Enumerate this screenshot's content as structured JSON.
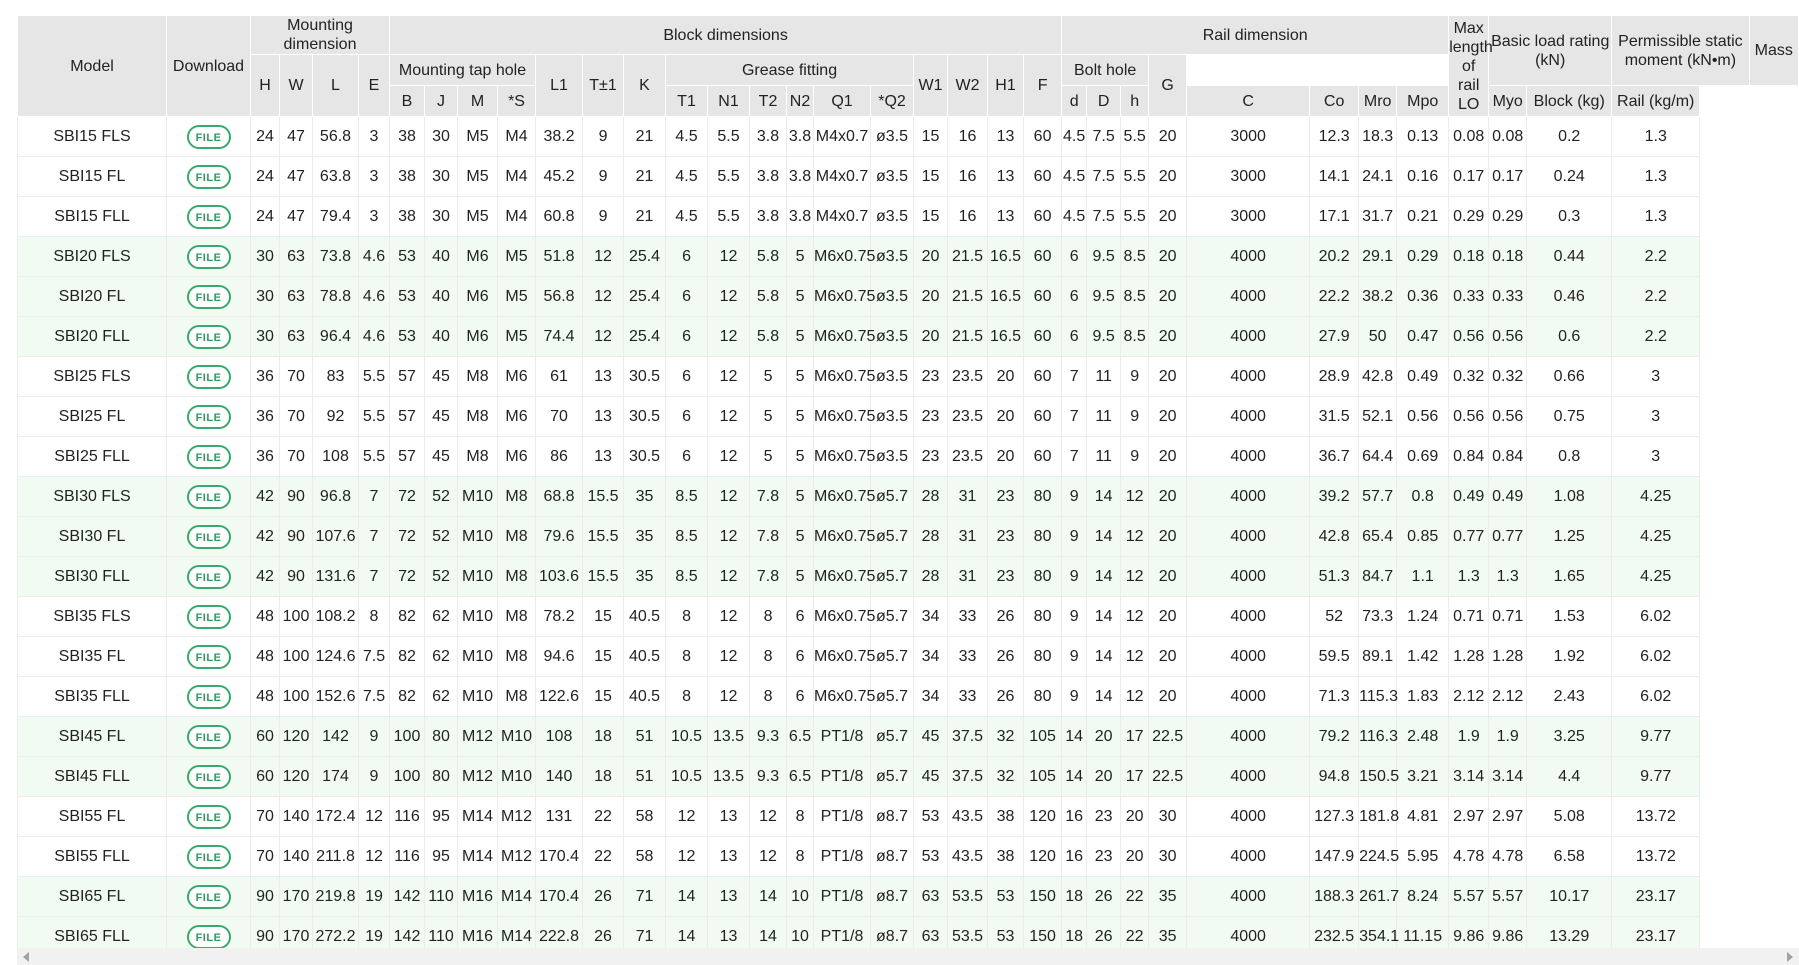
{
  "headers": {
    "model": "Model",
    "download": "Download",
    "groups": {
      "mounting": "Mounting dimension",
      "block": "Block dimensions",
      "rail": "Rail dimension",
      "max_length": "Max length of rail LO",
      "load": "Basic load rating (kN)",
      "moment": "Permissible static moment (kN•m)",
      "mass": "Mass"
    },
    "subgroups": {
      "tap_hole": "Mounting tap hole",
      "grease": "Grease fitting",
      "bolt_hole": "Bolt hole"
    },
    "columns": {
      "H": "H",
      "W": "W",
      "L": "L",
      "E": "E",
      "B": "B",
      "J": "J",
      "M": "M",
      "S": "*S",
      "L1": "L1",
      "T": "T±1",
      "K": "K",
      "T1": "T1",
      "N1": "N1",
      "T2": "T2",
      "N2": "N2",
      "Q1": "Q1",
      "Q2": "*Q2",
      "W1": "W1",
      "W2": "W2",
      "H1": "H1",
      "F": "F",
      "d": "d",
      "D": "D",
      "h": "h",
      "G": "G",
      "C": "C",
      "Co": "Co",
      "Mro": "Mro",
      "Mpo": "Mpo",
      "Myo": "Myo",
      "block": "Block (kg)",
      "rail": "Rail (kg/m)"
    }
  },
  "file_label": "FILE",
  "colors": {
    "row_white": "#ffffff",
    "row_green": "#f2fbf1",
    "header_bg": "#e6e6e6",
    "file_accent": "#3aa86b"
  },
  "rows": [
    {
      "model": "SBI15 FLS",
      "H": "24",
      "W": "47",
      "L": "56.8",
      "E": "3",
      "B": "38",
      "J": "30",
      "M": "M5",
      "S": "M4",
      "L1": "38.2",
      "T": "9",
      "K": "21",
      "T1": "4.5",
      "N1": "5.5",
      "T2": "3.8",
      "N2": "3.8",
      "Q1": "M4x0.7",
      "Q2": "ø3.5",
      "W1": "15",
      "W2": "16",
      "H1": "13",
      "F": "60",
      "d": "4.5",
      "D": "7.5",
      "h": "5.5",
      "G": "20",
      "LO": "3000",
      "C": "12.3",
      "Co": "18.3",
      "Mro": "0.13",
      "Mpo": "0.08",
      "Myo": "0.08",
      "block": "0.2",
      "rail": "1.3"
    },
    {
      "model": "SBI15 FL",
      "H": "24",
      "W": "47",
      "L": "63.8",
      "E": "3",
      "B": "38",
      "J": "30",
      "M": "M5",
      "S": "M4",
      "L1": "45.2",
      "T": "9",
      "K": "21",
      "T1": "4.5",
      "N1": "5.5",
      "T2": "3.8",
      "N2": "3.8",
      "Q1": "M4x0.7",
      "Q2": "ø3.5",
      "W1": "15",
      "W2": "16",
      "H1": "13",
      "F": "60",
      "d": "4.5",
      "D": "7.5",
      "h": "5.5",
      "G": "20",
      "LO": "3000",
      "C": "14.1",
      "Co": "24.1",
      "Mro": "0.16",
      "Mpo": "0.17",
      "Myo": "0.17",
      "block": "0.24",
      "rail": "1.3"
    },
    {
      "model": "SBI15 FLL",
      "H": "24",
      "W": "47",
      "L": "79.4",
      "E": "3",
      "B": "38",
      "J": "30",
      "M": "M5",
      "S": "M4",
      "L1": "60.8",
      "T": "9",
      "K": "21",
      "T1": "4.5",
      "N1": "5.5",
      "T2": "3.8",
      "N2": "3.8",
      "Q1": "M4x0.7",
      "Q2": "ø3.5",
      "W1": "15",
      "W2": "16",
      "H1": "13",
      "F": "60",
      "d": "4.5",
      "D": "7.5",
      "h": "5.5",
      "G": "20",
      "LO": "3000",
      "C": "17.1",
      "Co": "31.7",
      "Mro": "0.21",
      "Mpo": "0.29",
      "Myo": "0.29",
      "block": "0.3",
      "rail": "1.3"
    },
    {
      "model": "SBI20 FLS",
      "H": "30",
      "W": "63",
      "L": "73.8",
      "E": "4.6",
      "B": "53",
      "J": "40",
      "M": "M6",
      "S": "M5",
      "L1": "51.8",
      "T": "12",
      "K": "25.4",
      "T1": "6",
      "N1": "12",
      "T2": "5.8",
      "N2": "5",
      "Q1": "M6x0.75",
      "Q2": "ø3.5",
      "W1": "20",
      "W2": "21.5",
      "H1": "16.5",
      "F": "60",
      "d": "6",
      "D": "9.5",
      "h": "8.5",
      "G": "20",
      "LO": "4000",
      "C": "20.2",
      "Co": "29.1",
      "Mro": "0.29",
      "Mpo": "0.18",
      "Myo": "0.18",
      "block": "0.44",
      "rail": "2.2"
    },
    {
      "model": "SBI20 FL",
      "H": "30",
      "W": "63",
      "L": "78.8",
      "E": "4.6",
      "B": "53",
      "J": "40",
      "M": "M6",
      "S": "M5",
      "L1": "56.8",
      "T": "12",
      "K": "25.4",
      "T1": "6",
      "N1": "12",
      "T2": "5.8",
      "N2": "5",
      "Q1": "M6x0.75",
      "Q2": "ø3.5",
      "W1": "20",
      "W2": "21.5",
      "H1": "16.5",
      "F": "60",
      "d": "6",
      "D": "9.5",
      "h": "8.5",
      "G": "20",
      "LO": "4000",
      "C": "22.2",
      "Co": "38.2",
      "Mro": "0.36",
      "Mpo": "0.33",
      "Myo": "0.33",
      "block": "0.46",
      "rail": "2.2"
    },
    {
      "model": "SBI20 FLL",
      "H": "30",
      "W": "63",
      "L": "96.4",
      "E": "4.6",
      "B": "53",
      "J": "40",
      "M": "M6",
      "S": "M5",
      "L1": "74.4",
      "T": "12",
      "K": "25.4",
      "T1": "6",
      "N1": "12",
      "T2": "5.8",
      "N2": "5",
      "Q1": "M6x0.75",
      "Q2": "ø3.5",
      "W1": "20",
      "W2": "21.5",
      "H1": "16.5",
      "F": "60",
      "d": "6",
      "D": "9.5",
      "h": "8.5",
      "G": "20",
      "LO": "4000",
      "C": "27.9",
      "Co": "50",
      "Mro": "0.47",
      "Mpo": "0.56",
      "Myo": "0.56",
      "block": "0.6",
      "rail": "2.2"
    },
    {
      "model": "SBI25 FLS",
      "H": "36",
      "W": "70",
      "L": "83",
      "E": "5.5",
      "B": "57",
      "J": "45",
      "M": "M8",
      "S": "M6",
      "L1": "61",
      "T": "13",
      "K": "30.5",
      "T1": "6",
      "N1": "12",
      "T2": "5",
      "N2": "5",
      "Q1": "M6x0.75",
      "Q2": "ø3.5",
      "W1": "23",
      "W2": "23.5",
      "H1": "20",
      "F": "60",
      "d": "7",
      "D": "11",
      "h": "9",
      "G": "20",
      "LO": "4000",
      "C": "28.9",
      "Co": "42.8",
      "Mro": "0.49",
      "Mpo": "0.32",
      "Myo": "0.32",
      "block": "0.66",
      "rail": "3"
    },
    {
      "model": "SBI25 FL",
      "H": "36",
      "W": "70",
      "L": "92",
      "E": "5.5",
      "B": "57",
      "J": "45",
      "M": "M8",
      "S": "M6",
      "L1": "70",
      "T": "13",
      "K": "30.5",
      "T1": "6",
      "N1": "12",
      "T2": "5",
      "N2": "5",
      "Q1": "M6x0.75",
      "Q2": "ø3.5",
      "W1": "23",
      "W2": "23.5",
      "H1": "20",
      "F": "60",
      "d": "7",
      "D": "11",
      "h": "9",
      "G": "20",
      "LO": "4000",
      "C": "31.5",
      "Co": "52.1",
      "Mro": "0.56",
      "Mpo": "0.56",
      "Myo": "0.56",
      "block": "0.75",
      "rail": "3"
    },
    {
      "model": "SBI25 FLL",
      "H": "36",
      "W": "70",
      "L": "108",
      "E": "5.5",
      "B": "57",
      "J": "45",
      "M": "M8",
      "S": "M6",
      "L1": "86",
      "T": "13",
      "K": "30.5",
      "T1": "6",
      "N1": "12",
      "T2": "5",
      "N2": "5",
      "Q1": "M6x0.75",
      "Q2": "ø3.5",
      "W1": "23",
      "W2": "23.5",
      "H1": "20",
      "F": "60",
      "d": "7",
      "D": "11",
      "h": "9",
      "G": "20",
      "LO": "4000",
      "C": "36.7",
      "Co": "64.4",
      "Mro": "0.69",
      "Mpo": "0.84",
      "Myo": "0.84",
      "block": "0.8",
      "rail": "3"
    },
    {
      "model": "SBI30 FLS",
      "H": "42",
      "W": "90",
      "L": "96.8",
      "E": "7",
      "B": "72",
      "J": "52",
      "M": "M10",
      "S": "M8",
      "L1": "68.8",
      "T": "15.5",
      "K": "35",
      "T1": "8.5",
      "N1": "12",
      "T2": "7.8",
      "N2": "5",
      "Q1": "M6x0.75",
      "Q2": "ø5.7",
      "W1": "28",
      "W2": "31",
      "H1": "23",
      "F": "80",
      "d": "9",
      "D": "14",
      "h": "12",
      "G": "20",
      "LO": "4000",
      "C": "39.2",
      "Co": "57.7",
      "Mro": "0.8",
      "Mpo": "0.49",
      "Myo": "0.49",
      "block": "1.08",
      "rail": "4.25"
    },
    {
      "model": "SBI30 FL",
      "H": "42",
      "W": "90",
      "L": "107.6",
      "E": "7",
      "B": "72",
      "J": "52",
      "M": "M10",
      "S": "M8",
      "L1": "79.6",
      "T": "15.5",
      "K": "35",
      "T1": "8.5",
      "N1": "12",
      "T2": "7.8",
      "N2": "5",
      "Q1": "M6x0.75",
      "Q2": "ø5.7",
      "W1": "28",
      "W2": "31",
      "H1": "23",
      "F": "80",
      "d": "9",
      "D": "14",
      "h": "12",
      "G": "20",
      "LO": "4000",
      "C": "42.8",
      "Co": "65.4",
      "Mro": "0.85",
      "Mpo": "0.77",
      "Myo": "0.77",
      "block": "1.25",
      "rail": "4.25"
    },
    {
      "model": "SBI30 FLL",
      "H": "42",
      "W": "90",
      "L": "131.6",
      "E": "7",
      "B": "72",
      "J": "52",
      "M": "M10",
      "S": "M8",
      "L1": "103.6",
      "T": "15.5",
      "K": "35",
      "T1": "8.5",
      "N1": "12",
      "T2": "7.8",
      "N2": "5",
      "Q1": "M6x0.75",
      "Q2": "ø5.7",
      "W1": "28",
      "W2": "31",
      "H1": "23",
      "F": "80",
      "d": "9",
      "D": "14",
      "h": "12",
      "G": "20",
      "LO": "4000",
      "C": "51.3",
      "Co": "84.7",
      "Mro": "1.1",
      "Mpo": "1.3",
      "Myo": "1.3",
      "block": "1.65",
      "rail": "4.25"
    },
    {
      "model": "SBI35 FLS",
      "H": "48",
      "W": "100",
      "L": "108.2",
      "E": "8",
      "B": "82",
      "J": "62",
      "M": "M10",
      "S": "M8",
      "L1": "78.2",
      "T": "15",
      "K": "40.5",
      "T1": "8",
      "N1": "12",
      "T2": "8",
      "N2": "6",
      "Q1": "M6x0.75",
      "Q2": "ø5.7",
      "W1": "34",
      "W2": "33",
      "H1": "26",
      "F": "80",
      "d": "9",
      "D": "14",
      "h": "12",
      "G": "20",
      "LO": "4000",
      "C": "52",
      "Co": "73.3",
      "Mro": "1.24",
      "Mpo": "0.71",
      "Myo": "0.71",
      "block": "1.53",
      "rail": "6.02"
    },
    {
      "model": "SBI35 FL",
      "H": "48",
      "W": "100",
      "L": "124.6",
      "E": "7.5",
      "B": "82",
      "J": "62",
      "M": "M10",
      "S": "M8",
      "L1": "94.6",
      "T": "15",
      "K": "40.5",
      "T1": "8",
      "N1": "12",
      "T2": "8",
      "N2": "6",
      "Q1": "M6x0.75",
      "Q2": "ø5.7",
      "W1": "34",
      "W2": "33",
      "H1": "26",
      "F": "80",
      "d": "9",
      "D": "14",
      "h": "12",
      "G": "20",
      "LO": "4000",
      "C": "59.5",
      "Co": "89.1",
      "Mro": "1.42",
      "Mpo": "1.28",
      "Myo": "1.28",
      "block": "1.92",
      "rail": "6.02"
    },
    {
      "model": "SBI35 FLL",
      "H": "48",
      "W": "100",
      "L": "152.6",
      "E": "7.5",
      "B": "82",
      "J": "62",
      "M": "M10",
      "S": "M8",
      "L1": "122.6",
      "T": "15",
      "K": "40.5",
      "T1": "8",
      "N1": "12",
      "T2": "8",
      "N2": "6",
      "Q1": "M6x0.75",
      "Q2": "ø5.7",
      "W1": "34",
      "W2": "33",
      "H1": "26",
      "F": "80",
      "d": "9",
      "D": "14",
      "h": "12",
      "G": "20",
      "LO": "4000",
      "C": "71.3",
      "Co": "115.3",
      "Mro": "1.83",
      "Mpo": "2.12",
      "Myo": "2.12",
      "block": "2.43",
      "rail": "6.02"
    },
    {
      "model": "SBI45 FL",
      "H": "60",
      "W": "120",
      "L": "142",
      "E": "9",
      "B": "100",
      "J": "80",
      "M": "M12",
      "S": "M10",
      "L1": "108",
      "T": "18",
      "K": "51",
      "T1": "10.5",
      "N1": "13.5",
      "T2": "9.3",
      "N2": "6.5",
      "Q1": "PT1/8",
      "Q2": "ø5.7",
      "W1": "45",
      "W2": "37.5",
      "H1": "32",
      "F": "105",
      "d": "14",
      "D": "20",
      "h": "17",
      "G": "22.5",
      "LO": "4000",
      "C": "79.2",
      "Co": "116.3",
      "Mro": "2.48",
      "Mpo": "1.9",
      "Myo": "1.9",
      "block": "3.25",
      "rail": "9.77"
    },
    {
      "model": "SBI45 FLL",
      "H": "60",
      "W": "120",
      "L": "174",
      "E": "9",
      "B": "100",
      "J": "80",
      "M": "M12",
      "S": "M10",
      "L1": "140",
      "T": "18",
      "K": "51",
      "T1": "10.5",
      "N1": "13.5",
      "T2": "9.3",
      "N2": "6.5",
      "Q1": "PT1/8",
      "Q2": "ø5.7",
      "W1": "45",
      "W2": "37.5",
      "H1": "32",
      "F": "105",
      "d": "14",
      "D": "20",
      "h": "17",
      "G": "22.5",
      "LO": "4000",
      "C": "94.8",
      "Co": "150.5",
      "Mro": "3.21",
      "Mpo": "3.14",
      "Myo": "3.14",
      "block": "4.4",
      "rail": "9.77"
    },
    {
      "model": "SBI55 FL",
      "H": "70",
      "W": "140",
      "L": "172.4",
      "E": "12",
      "B": "116",
      "J": "95",
      "M": "M14",
      "S": "M12",
      "L1": "131",
      "T": "22",
      "K": "58",
      "T1": "12",
      "N1": "13",
      "T2": "12",
      "N2": "8",
      "Q1": "PT1/8",
      "Q2": "ø8.7",
      "W1": "53",
      "W2": "43.5",
      "H1": "38",
      "F": "120",
      "d": "16",
      "D": "23",
      "h": "20",
      "G": "30",
      "LO": "4000",
      "C": "127.3",
      "Co": "181.8",
      "Mro": "4.81",
      "Mpo": "2.97",
      "Myo": "2.97",
      "block": "5.08",
      "rail": "13.72"
    },
    {
      "model": "SBI55 FLL",
      "H": "70",
      "W": "140",
      "L": "211.8",
      "E": "12",
      "B": "116",
      "J": "95",
      "M": "M14",
      "S": "M12",
      "L1": "170.4",
      "T": "22",
      "K": "58",
      "T1": "12",
      "N1": "13",
      "T2": "12",
      "N2": "8",
      "Q1": "PT1/8",
      "Q2": "ø8.7",
      "W1": "53",
      "W2": "43.5",
      "H1": "38",
      "F": "120",
      "d": "16",
      "D": "23",
      "h": "20",
      "G": "30",
      "LO": "4000",
      "C": "147.9",
      "Co": "224.5",
      "Mro": "5.95",
      "Mpo": "4.78",
      "Myo": "4.78",
      "block": "6.58",
      "rail": "13.72"
    },
    {
      "model": "SBI65 FL",
      "H": "90",
      "W": "170",
      "L": "219.8",
      "E": "19",
      "B": "142",
      "J": "110",
      "M": "M16",
      "S": "M14",
      "L1": "170.4",
      "T": "26",
      "K": "71",
      "T1": "14",
      "N1": "13",
      "T2": "14",
      "N2": "10",
      "Q1": "PT1/8",
      "Q2": "ø8.7",
      "W1": "63",
      "W2": "53.5",
      "H1": "53",
      "F": "150",
      "d": "18",
      "D": "26",
      "h": "22",
      "G": "35",
      "LO": "4000",
      "C": "188.3",
      "Co": "261.7",
      "Mro": "8.24",
      "Mpo": "5.57",
      "Myo": "5.57",
      "block": "10.17",
      "rail": "23.17"
    },
    {
      "model": "SBI65 FLL",
      "H": "90",
      "W": "170",
      "L": "272.2",
      "E": "19",
      "B": "142",
      "J": "110",
      "M": "M16",
      "S": "M14",
      "L1": "222.8",
      "T": "26",
      "K": "71",
      "T1": "14",
      "N1": "13",
      "T2": "14",
      "N2": "10",
      "Q1": "PT1/8",
      "Q2": "ø8.7",
      "W1": "63",
      "W2": "53.5",
      "H1": "53",
      "F": "150",
      "d": "18",
      "D": "26",
      "h": "22",
      "G": "35",
      "LO": "4000",
      "C": "232.5",
      "Co": "354.1",
      "Mro": "11.15",
      "Mpo": "9.86",
      "Myo": "9.86",
      "block": "13.29",
      "rail": "23.17"
    }
  ]
}
